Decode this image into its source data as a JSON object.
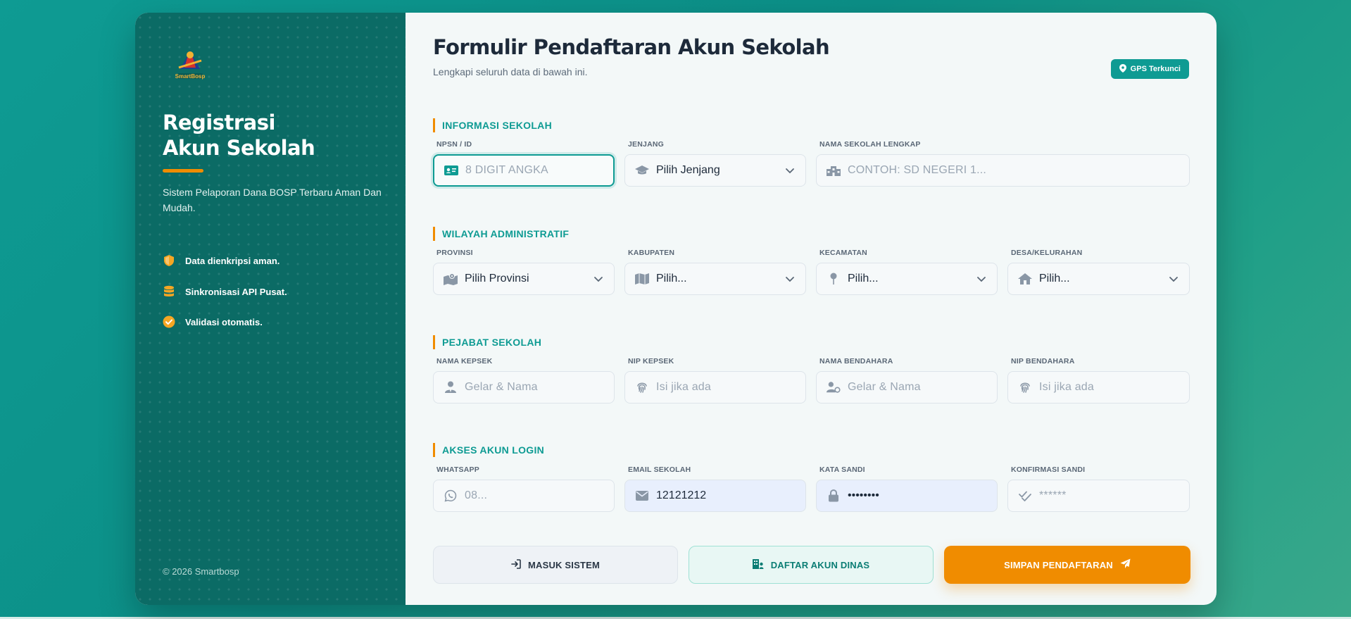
{
  "side": {
    "logo_text": "SmartBosp",
    "title_line1": "Registrasi",
    "title_line2": "Akun Sekolah",
    "description": "Sistem Pelaporan Dana BOSP Terbaru Aman Dan Mudah.",
    "features": [
      {
        "label": "Data dienkripsi aman.",
        "icon": "shield-icon"
      },
      {
        "label": "Sinkronisasi API Pusat.",
        "icon": "database-icon"
      },
      {
        "label": "Validasi otomatis.",
        "icon": "check-circle-icon"
      }
    ],
    "footer": "© 2026 Smartbosp"
  },
  "header": {
    "title": "Formulir Pendaftaran Akun Sekolah",
    "subtitle": "Lengkapi seluruh data di bawah ini.",
    "gps_badge": "GPS Terkunci"
  },
  "sections": {
    "school": "INFORMASI SEKOLAH",
    "region": "WILAYAH ADMINISTRATIF",
    "officials": "PEJABAT SEKOLAH",
    "account": "AKSES AKUN LOGIN"
  },
  "fields": {
    "npsn": {
      "label": "NPSN / ID",
      "placeholder": "8 DIGIT ANGKA",
      "value": ""
    },
    "jenjang": {
      "label": "JENJANG",
      "value": "Pilih Jenjang"
    },
    "nama_sekolah": {
      "label": "NAMA SEKOLAH LENGKAP",
      "placeholder": "CONTOH: SD NEGERI 1...",
      "value": ""
    },
    "provinsi": {
      "label": "PROVINSI",
      "value": "Pilih Provinsi"
    },
    "kabupaten": {
      "label": "KABUPATEN",
      "value": "Pilih..."
    },
    "kecamatan": {
      "label": "KECAMATAN",
      "value": "Pilih..."
    },
    "desa": {
      "label": "DESA/KELURAHAN",
      "value": "Pilih..."
    },
    "nama_kepsek": {
      "label": "NAMA KEPSEK",
      "placeholder": "Gelar & Nama",
      "value": ""
    },
    "nip_kepsek": {
      "label": "NIP KEPSEK",
      "placeholder": "Isi jika ada",
      "value": ""
    },
    "nama_bendahara": {
      "label": "NAMA BENDAHARA",
      "placeholder": "Gelar & Nama",
      "value": ""
    },
    "nip_bendahara": {
      "label": "NIP BENDAHARA",
      "placeholder": "Isi jika ada",
      "value": ""
    },
    "whatsapp": {
      "label": "WHATSAPP",
      "placeholder": "08...",
      "value": ""
    },
    "email": {
      "label": "EMAIL SEKOLAH",
      "value": "12121212"
    },
    "password": {
      "label": "KATA SANDI",
      "value": "••••••••"
    },
    "confirm_password": {
      "label": "KONFIRMASI SANDI",
      "placeholder": "******",
      "value": ""
    }
  },
  "buttons": {
    "login": "MASUK SISTEM",
    "dinas": "DAFTAR AKUN DINAS",
    "save": "SIMPAN PENDAFTARAN"
  },
  "colors": {
    "teal": "#0e9b93",
    "dark_teal": "#0b6b65",
    "orange": "#f08c00"
  }
}
